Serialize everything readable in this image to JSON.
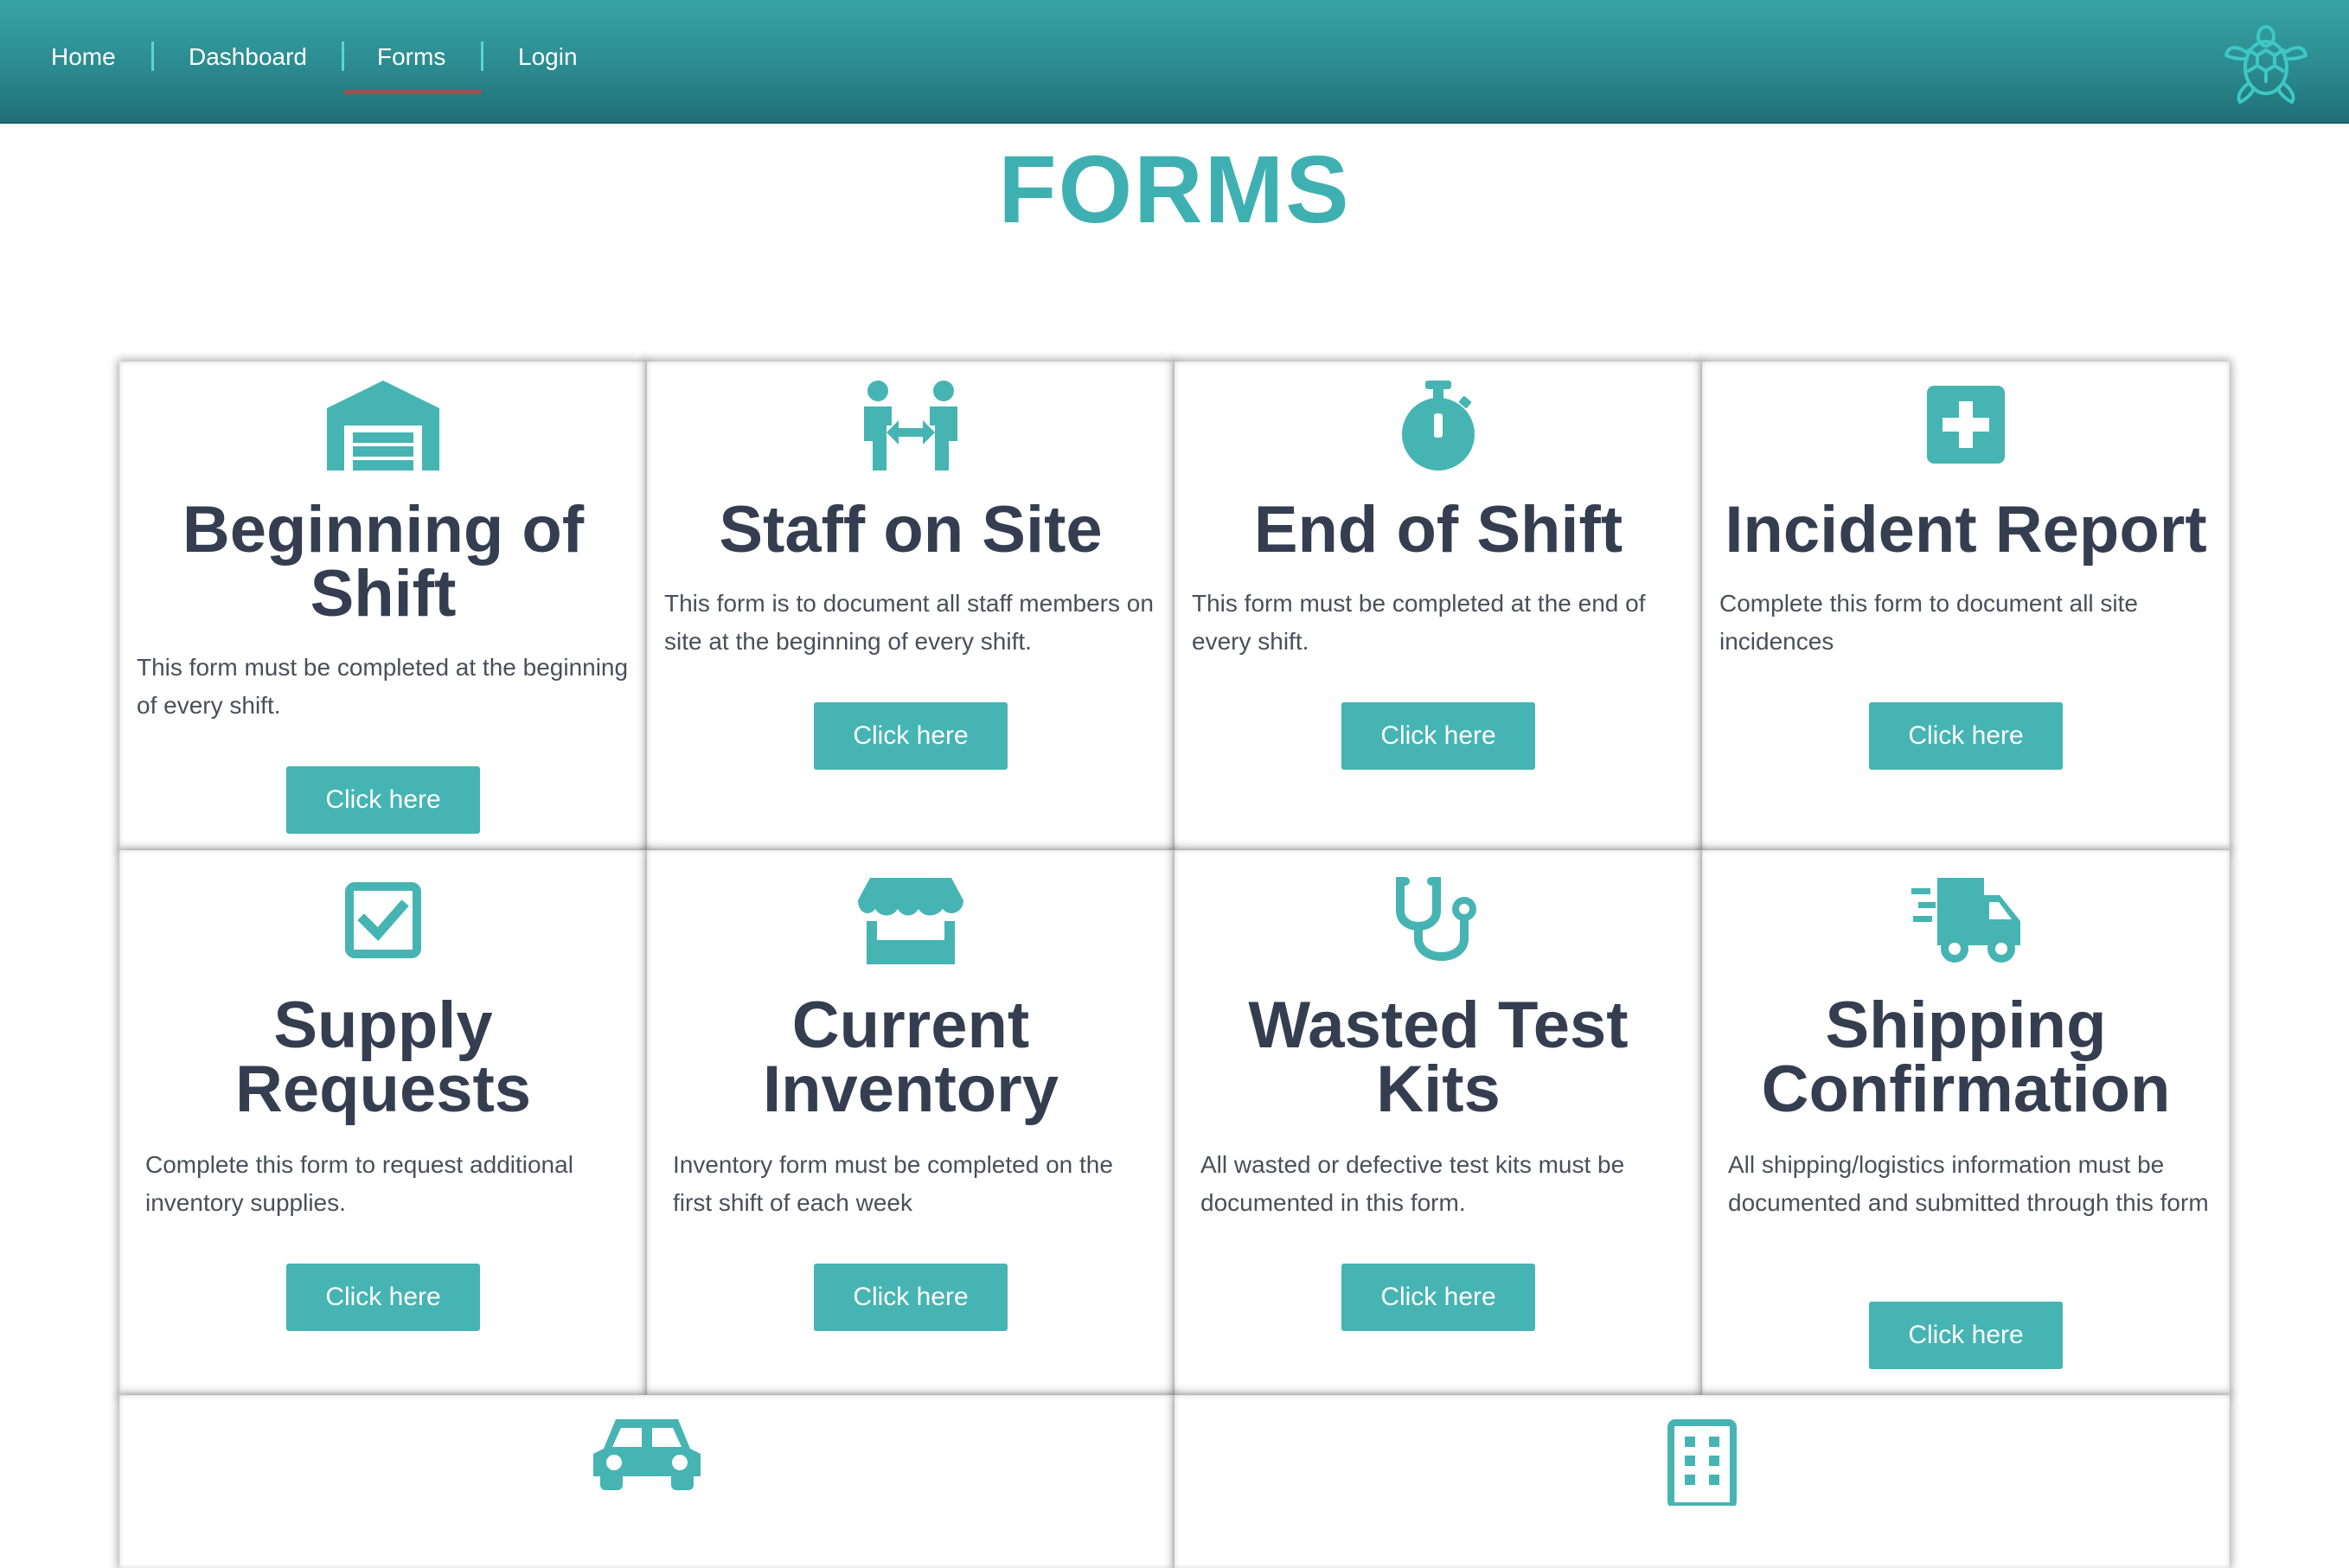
{
  "nav": {
    "items": [
      {
        "label": "Home"
      },
      {
        "label": "Dashboard"
      },
      {
        "label": "Forms"
      },
      {
        "label": "Login"
      }
    ],
    "active": "Forms"
  },
  "logo": {
    "icon": "turtle-icon"
  },
  "page": {
    "title": "FORMS"
  },
  "colors": {
    "accent": "#46b4b3",
    "nav_gradient_top": "#36a3a6",
    "nav_gradient_bottom": "#216f76",
    "heading": "#343e50",
    "title": "#3fb0b2"
  },
  "cards": [
    {
      "icon": "warehouse-icon",
      "title": "Beginning of Shift",
      "description": "This form must be completed at the beginning of every shift.",
      "button": "Click here"
    },
    {
      "icon": "people-arrows-icon",
      "title": "Staff on Site",
      "description": "This form is to document all staff members on site at the beginning of every shift.",
      "button": "Click here"
    },
    {
      "icon": "stopwatch-icon",
      "title": "End of Shift",
      "description": "This form must be completed at the end of every shift.",
      "button": "Click here"
    },
    {
      "icon": "first-aid-icon",
      "title": "Incident Report",
      "description": "Complete this form to document all site incidences",
      "button": "Click here"
    },
    {
      "icon": "checkbox-icon",
      "title": "Supply Requests",
      "description": "Complete this form to request additional inventory supplies.",
      "button": "Click here"
    },
    {
      "icon": "store-icon",
      "title": "Current Inventory",
      "description": "Inventory form must be completed on the first shift of each week",
      "button": "Click here"
    },
    {
      "icon": "stethoscope-icon",
      "title": "Wasted Test Kits",
      "description": "All wasted or defective test kits must be documented in this form.",
      "button": "Click here"
    },
    {
      "icon": "shipping-truck-icon",
      "title": "Shipping Confirmation",
      "description": "All shipping/logistics information must be documented and submitted through this form",
      "button": "Click here"
    },
    {
      "icon": "car-icon"
    },
    {
      "icon": "building-icon"
    }
  ]
}
